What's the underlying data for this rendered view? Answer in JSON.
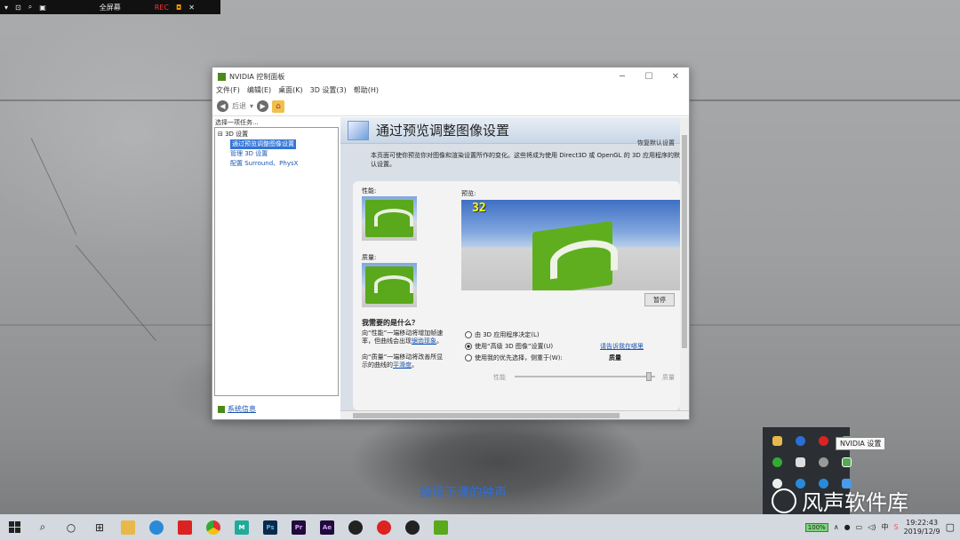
{
  "recorder": {
    "fullscreen_label": "全屏幕",
    "rec_label": "REC"
  },
  "window": {
    "title": "NVIDIA 控制面板",
    "controls": [
      "─",
      "☐",
      "✕"
    ],
    "menu": [
      "文件(F)",
      "编辑(E)",
      "桌面(K)",
      "3D 设置(3)",
      "帮助(H)"
    ],
    "toolbar": {
      "back_label": "后退"
    },
    "left": {
      "caption": "选择一项任务...",
      "tree_root": "3D 设置",
      "tree_items": [
        "通过预览调整图像设置",
        "管理 3D 设置",
        "配置 Surround、PhysX"
      ],
      "system_info": "系统信息"
    },
    "content": {
      "title": "通过预览调整图像设置",
      "restore": "恢复默认设置",
      "description": "本页面可使你预览你对图像和渲染设置所作的变化。这些将成为使用 Direct3D 或 OpenGL 的 3D 应用程序的默认设置。",
      "performance_label": "性能:",
      "quality_label": "质量:",
      "preview_label": "预览:",
      "fps": "32",
      "pause": "暂停",
      "need_title": "我需要的是什么？",
      "need_text1a": "向“性能”一端移动将增加帧速率，但曲线会出现",
      "need_link1": "锯齿现象",
      "need_text2a": "向“质量”一端移动将改善所显示的曲线的",
      "need_link2": "平滑度",
      "radio1": "由 3D 应用程序决定(L)",
      "radio2": "使用“高级 3D 图像”设置(U)",
      "radio3": "使用我的优先选择，侧重于(W):",
      "where_link": "请告诉我在哪里",
      "quality_bold": "质量",
      "slider_perf": "性能",
      "slider_qual": "质量"
    }
  },
  "tray": {
    "tooltip": "NVIDIA 设置"
  },
  "subtitle": "操场下课的钟声",
  "watermark": "风声软件库",
  "taskbar": {
    "apps": [
      "",
      "",
      "",
      "",
      "M",
      "Ps",
      "Pr",
      "Ae",
      "",
      "",
      "",
      ""
    ],
    "battery": "100%",
    "ime": "中",
    "time": "19:22:43",
    "date": "2019/12/9"
  }
}
